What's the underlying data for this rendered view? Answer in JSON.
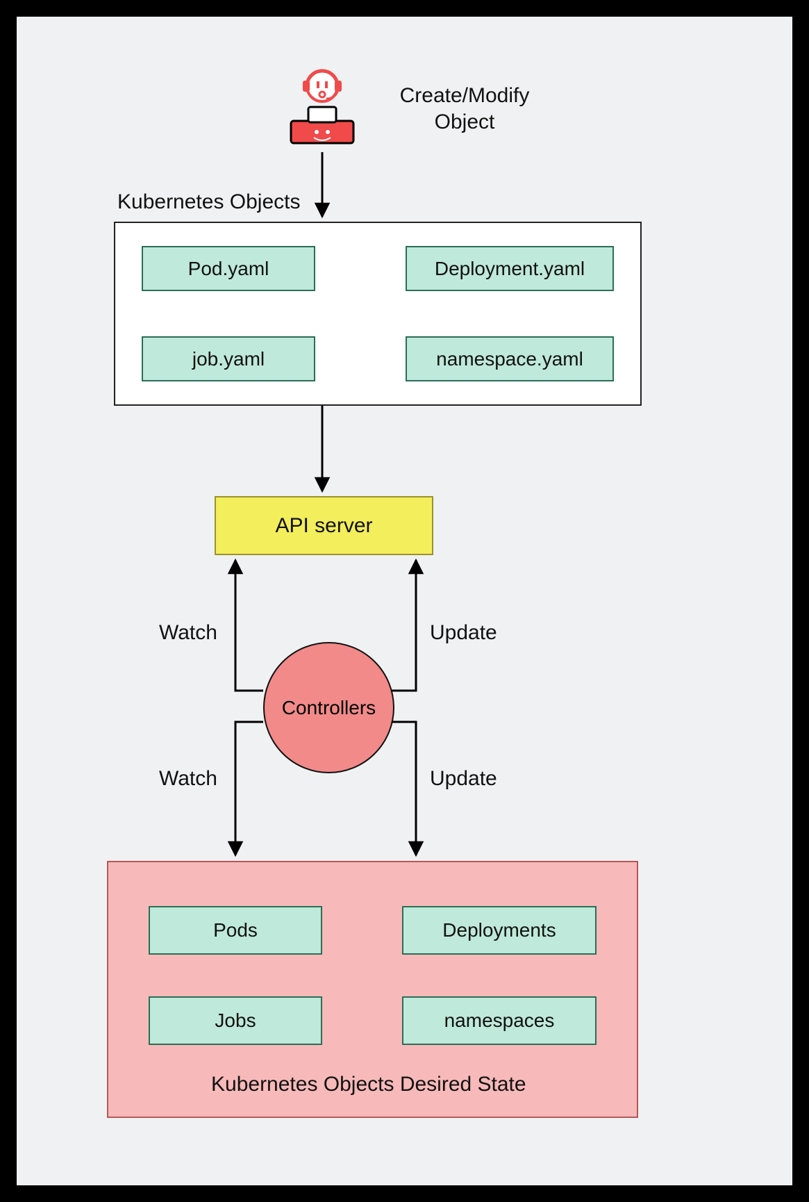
{
  "user_label_line1": "Create/Modify",
  "user_label_line2": "Object",
  "objects_title": "Kubernetes Objects",
  "objects": {
    "pod": "Pod.yaml",
    "deployment": "Deployment.yaml",
    "job": "job.yaml",
    "namespace": "namespace.yaml"
  },
  "api_server": "API server",
  "controllers": "Controllers",
  "edge_watch_top": "Watch",
  "edge_update_top": "Update",
  "edge_watch_bottom": "Watch",
  "edge_update_bottom": "Update",
  "state_title": "Kubernetes Objects Desired State",
  "state": {
    "pods": "Pods",
    "deployments": "Deployments",
    "jobs": "Jobs",
    "namespaces": "namespaces"
  },
  "colors": {
    "mint": "#bfe9da",
    "yellow": "#f3ee5b",
    "pink": "#f7b9b9",
    "red": "#f04a4a"
  }
}
